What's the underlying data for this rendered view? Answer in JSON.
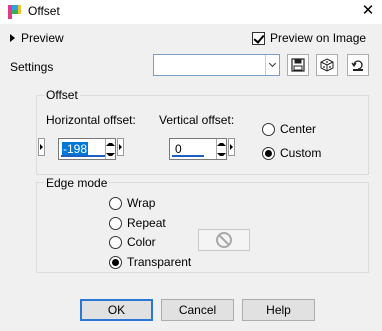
{
  "window": {
    "title": "Offset"
  },
  "header": {
    "preview_label": "Preview",
    "preview_on_image_label": "Preview on Image",
    "preview_on_image_checked": true
  },
  "settings": {
    "label": "Settings",
    "value": ""
  },
  "offset_group": {
    "title": "Offset",
    "horizontal_label": "Horizontal offset:",
    "horizontal_value": "-198",
    "vertical_label": "Vertical offset:",
    "vertical_value": "0",
    "options": [
      "Center",
      "Custom"
    ],
    "selected": "Custom"
  },
  "edge_mode_group": {
    "title": "Edge mode",
    "options": [
      "Wrap",
      "Repeat",
      "Color",
      "Transparent"
    ],
    "selected": "Transparent"
  },
  "buttons": {
    "ok": "OK",
    "cancel": "Cancel",
    "help": "Help"
  },
  "colors": {
    "accent": "#2a77d6",
    "selection": "#0078d7"
  }
}
